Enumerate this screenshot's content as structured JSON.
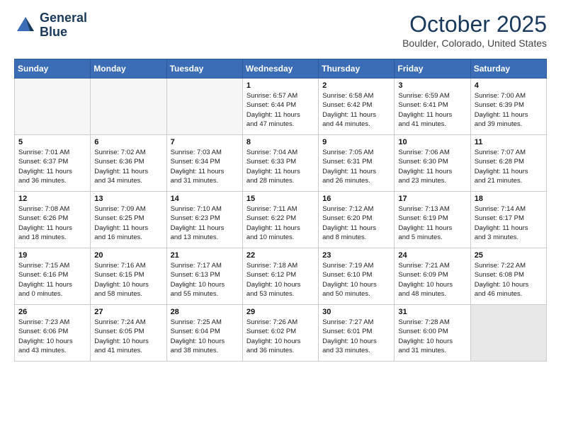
{
  "header": {
    "logo_line1": "General",
    "logo_line2": "Blue",
    "month": "October 2025",
    "location": "Boulder, Colorado, United States"
  },
  "weekdays": [
    "Sunday",
    "Monday",
    "Tuesday",
    "Wednesday",
    "Thursday",
    "Friday",
    "Saturday"
  ],
  "weeks": [
    [
      {
        "day": "",
        "info": "",
        "empty": true
      },
      {
        "day": "",
        "info": "",
        "empty": true
      },
      {
        "day": "",
        "info": "",
        "empty": true
      },
      {
        "day": "1",
        "info": "Sunrise: 6:57 AM\nSunset: 6:44 PM\nDaylight: 11 hours\nand 47 minutes."
      },
      {
        "day": "2",
        "info": "Sunrise: 6:58 AM\nSunset: 6:42 PM\nDaylight: 11 hours\nand 44 minutes."
      },
      {
        "day": "3",
        "info": "Sunrise: 6:59 AM\nSunset: 6:41 PM\nDaylight: 11 hours\nand 41 minutes."
      },
      {
        "day": "4",
        "info": "Sunrise: 7:00 AM\nSunset: 6:39 PM\nDaylight: 11 hours\nand 39 minutes."
      }
    ],
    [
      {
        "day": "5",
        "info": "Sunrise: 7:01 AM\nSunset: 6:37 PM\nDaylight: 11 hours\nand 36 minutes."
      },
      {
        "day": "6",
        "info": "Sunrise: 7:02 AM\nSunset: 6:36 PM\nDaylight: 11 hours\nand 34 minutes."
      },
      {
        "day": "7",
        "info": "Sunrise: 7:03 AM\nSunset: 6:34 PM\nDaylight: 11 hours\nand 31 minutes."
      },
      {
        "day": "8",
        "info": "Sunrise: 7:04 AM\nSunset: 6:33 PM\nDaylight: 11 hours\nand 28 minutes."
      },
      {
        "day": "9",
        "info": "Sunrise: 7:05 AM\nSunset: 6:31 PM\nDaylight: 11 hours\nand 26 minutes."
      },
      {
        "day": "10",
        "info": "Sunrise: 7:06 AM\nSunset: 6:30 PM\nDaylight: 11 hours\nand 23 minutes."
      },
      {
        "day": "11",
        "info": "Sunrise: 7:07 AM\nSunset: 6:28 PM\nDaylight: 11 hours\nand 21 minutes."
      }
    ],
    [
      {
        "day": "12",
        "info": "Sunrise: 7:08 AM\nSunset: 6:26 PM\nDaylight: 11 hours\nand 18 minutes."
      },
      {
        "day": "13",
        "info": "Sunrise: 7:09 AM\nSunset: 6:25 PM\nDaylight: 11 hours\nand 16 minutes."
      },
      {
        "day": "14",
        "info": "Sunrise: 7:10 AM\nSunset: 6:23 PM\nDaylight: 11 hours\nand 13 minutes."
      },
      {
        "day": "15",
        "info": "Sunrise: 7:11 AM\nSunset: 6:22 PM\nDaylight: 11 hours\nand 10 minutes."
      },
      {
        "day": "16",
        "info": "Sunrise: 7:12 AM\nSunset: 6:20 PM\nDaylight: 11 hours\nand 8 minutes."
      },
      {
        "day": "17",
        "info": "Sunrise: 7:13 AM\nSunset: 6:19 PM\nDaylight: 11 hours\nand 5 minutes."
      },
      {
        "day": "18",
        "info": "Sunrise: 7:14 AM\nSunset: 6:17 PM\nDaylight: 11 hours\nand 3 minutes."
      }
    ],
    [
      {
        "day": "19",
        "info": "Sunrise: 7:15 AM\nSunset: 6:16 PM\nDaylight: 11 hours\nand 0 minutes."
      },
      {
        "day": "20",
        "info": "Sunrise: 7:16 AM\nSunset: 6:15 PM\nDaylight: 10 hours\nand 58 minutes."
      },
      {
        "day": "21",
        "info": "Sunrise: 7:17 AM\nSunset: 6:13 PM\nDaylight: 10 hours\nand 55 minutes."
      },
      {
        "day": "22",
        "info": "Sunrise: 7:18 AM\nSunset: 6:12 PM\nDaylight: 10 hours\nand 53 minutes."
      },
      {
        "day": "23",
        "info": "Sunrise: 7:19 AM\nSunset: 6:10 PM\nDaylight: 10 hours\nand 50 minutes."
      },
      {
        "day": "24",
        "info": "Sunrise: 7:21 AM\nSunset: 6:09 PM\nDaylight: 10 hours\nand 48 minutes."
      },
      {
        "day": "25",
        "info": "Sunrise: 7:22 AM\nSunset: 6:08 PM\nDaylight: 10 hours\nand 46 minutes."
      }
    ],
    [
      {
        "day": "26",
        "info": "Sunrise: 7:23 AM\nSunset: 6:06 PM\nDaylight: 10 hours\nand 43 minutes."
      },
      {
        "day": "27",
        "info": "Sunrise: 7:24 AM\nSunset: 6:05 PM\nDaylight: 10 hours\nand 41 minutes."
      },
      {
        "day": "28",
        "info": "Sunrise: 7:25 AM\nSunset: 6:04 PM\nDaylight: 10 hours\nand 38 minutes."
      },
      {
        "day": "29",
        "info": "Sunrise: 7:26 AM\nSunset: 6:02 PM\nDaylight: 10 hours\nand 36 minutes."
      },
      {
        "day": "30",
        "info": "Sunrise: 7:27 AM\nSunset: 6:01 PM\nDaylight: 10 hours\nand 33 minutes."
      },
      {
        "day": "31",
        "info": "Sunrise: 7:28 AM\nSunset: 6:00 PM\nDaylight: 10 hours\nand 31 minutes."
      },
      {
        "day": "",
        "info": "",
        "empty": true,
        "shaded": true
      }
    ]
  ]
}
